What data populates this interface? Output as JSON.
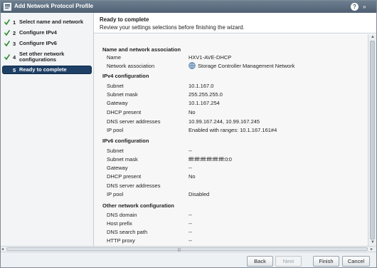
{
  "window": {
    "title": "Add Network Protocol Profile",
    "help": "?",
    "expand": "»"
  },
  "steps": [
    {
      "num": "1",
      "label": "Select name and network",
      "done": true
    },
    {
      "num": "2",
      "label": "Configure IPv4",
      "done": true
    },
    {
      "num": "3",
      "label": "Configure IPv6",
      "done": true
    },
    {
      "num": "4",
      "label": "Set other network configurations",
      "done": true
    },
    {
      "num": "5",
      "label": "Ready to complete",
      "done": false,
      "active": true
    }
  ],
  "header": {
    "title": "Ready to complete",
    "subtitle": "Review your settings selections before finishing the wizard."
  },
  "sections": {
    "name_network": {
      "title": "Name and network association",
      "rows": [
        {
          "key": "Name",
          "value": "HXV1-AVE-DHCP"
        },
        {
          "key": "Network association",
          "value": "Storage Controller Management Network"
        }
      ]
    },
    "ipv4": {
      "title": "IPv4 configuration",
      "rows": [
        {
          "key": "Subnet",
          "value": "10.1.167.0"
        },
        {
          "key": "Subnet mask",
          "value": "255.255.255.0"
        },
        {
          "key": "Gateway",
          "value": "10.1.167.254"
        },
        {
          "key": "DHCP present",
          "value": "No"
        },
        {
          "key": "DNS server addresses",
          "value": "10.99.167.244, 10.99.167.245"
        },
        {
          "key": "IP pool",
          "value": "Enabled with ranges: 10.1.167.161#4"
        }
      ]
    },
    "ipv6": {
      "title": "IPv6 configuration",
      "rows": [
        {
          "key": "Subnet",
          "value": "--"
        },
        {
          "key": "Subnet mask",
          "value": "ffff:ffff:ffff:ffff:ffff:ffff:0:0"
        },
        {
          "key": "Gateway",
          "value": "--"
        },
        {
          "key": "DHCP present",
          "value": "No"
        },
        {
          "key": "DNS server addresses",
          "value": ""
        },
        {
          "key": "IP pool",
          "value": "Disabled"
        }
      ]
    },
    "other": {
      "title": "Other network configuration",
      "rows": [
        {
          "key": "DNS domain",
          "value": "--"
        },
        {
          "key": "Host prefix",
          "value": "--"
        },
        {
          "key": "DNS search path",
          "value": "--"
        },
        {
          "key": "HTTP proxy",
          "value": "--"
        }
      ]
    }
  },
  "buttons": {
    "back": "Back",
    "next": "Next",
    "finish": "Finish",
    "cancel": "Cancel"
  },
  "scroll": {
    "grip": "|||"
  },
  "icons": {
    "check": "check-icon",
    "network": "network-icon",
    "help": "help-icon"
  },
  "colors": {
    "titlebar": "#5a6c7e",
    "active_step": "#1e3f66",
    "check": "#2e8b2e"
  }
}
